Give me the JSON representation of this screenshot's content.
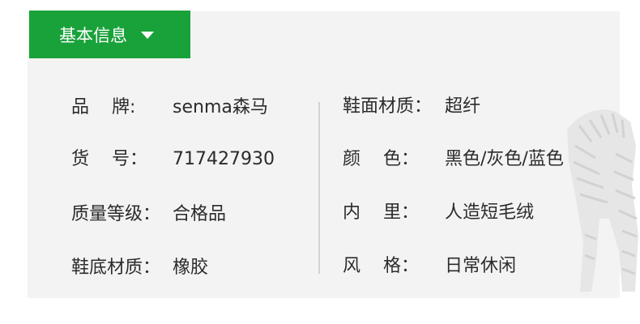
{
  "tab": {
    "label": "基本信息",
    "icon": "caret-down-icon",
    "color": "#1aa23a"
  },
  "left_column": [
    {
      "label": "品    牌:",
      "value": "senma森马"
    },
    {
      "label": "货    号：",
      "value": "717427930"
    },
    {
      "label": "质量等级：",
      "value": "合格品"
    },
    {
      "label": "鞋底材质：",
      "value": "橡胶"
    }
  ],
  "right_column": [
    {
      "label": "鞋面材质：",
      "value": "超纤"
    },
    {
      "label": "颜    色：",
      "value": "黑色/灰色/蓝色"
    },
    {
      "label": "内    里：",
      "value": "人造短毛绒"
    },
    {
      "label": "风    格：",
      "value": "日常休闲"
    }
  ],
  "watermark_icon": "zebra-icon"
}
